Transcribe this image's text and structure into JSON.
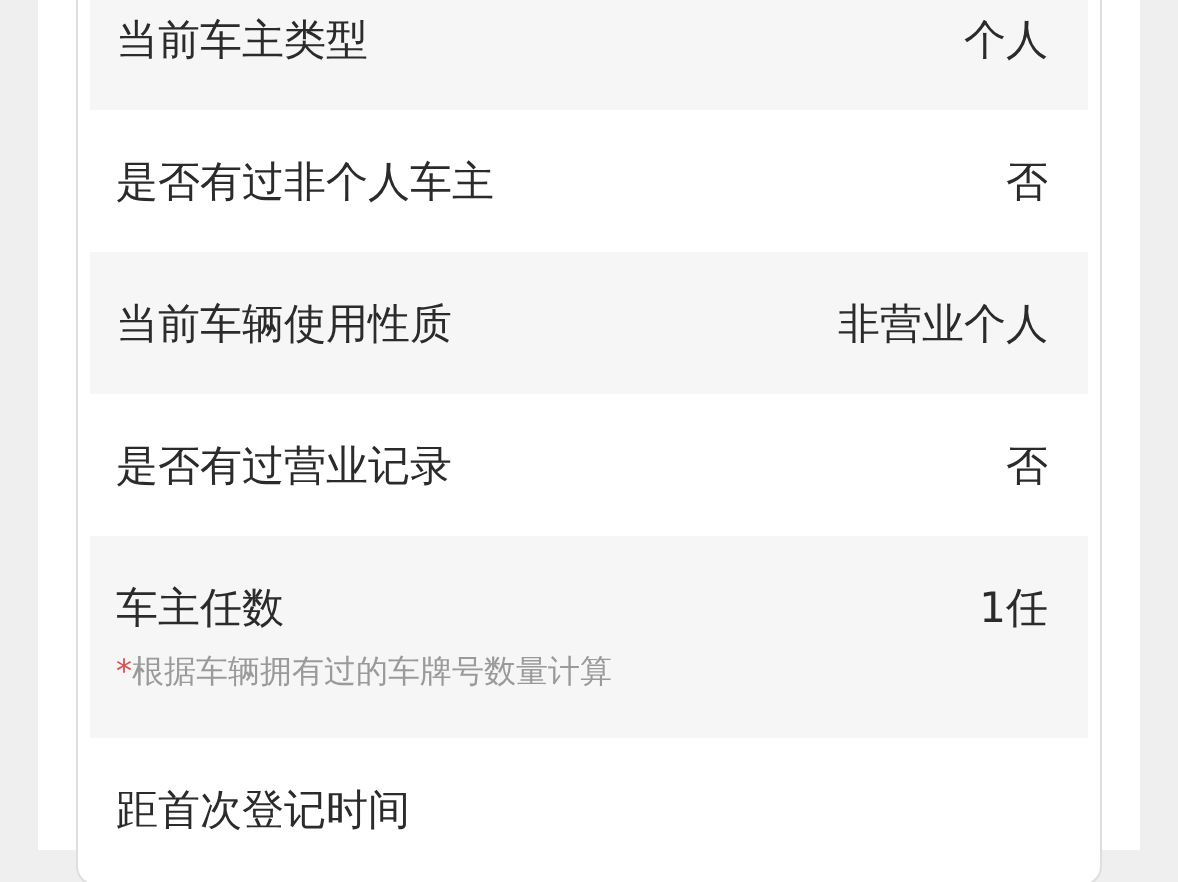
{
  "rows": [
    {
      "label": "当前车主类型",
      "value": "个人"
    },
    {
      "label": "是否有过非个人车主",
      "value": "否"
    },
    {
      "label": "当前车辆使用性质",
      "value": "非营业个人"
    },
    {
      "label": "是否有过营业记录",
      "value": "否"
    },
    {
      "label": "车主任数",
      "value": "1任",
      "note": {
        "mark": "*",
        "text": "根据车辆拥有过的车牌号数量计算"
      }
    },
    {
      "label": "距首次登记时间"
    }
  ]
}
